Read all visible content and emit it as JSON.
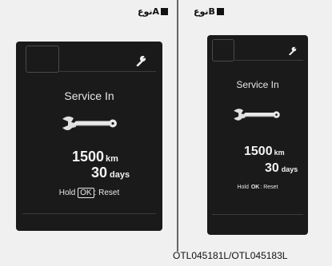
{
  "panels": [
    {
      "type_label": "نوعA",
      "display": {
        "title": "Service In",
        "distance_value": "1500",
        "distance_unit": "km",
        "days_value": "30",
        "days_unit": "days",
        "hold_label": "Hold",
        "ok_label": "OK",
        "reset_label": ": Reset"
      }
    },
    {
      "type_label": "نوعB",
      "display": {
        "title": "Service In",
        "distance_value": "1500",
        "distance_unit": "km",
        "days_value": "30",
        "days_unit": "days",
        "hold_label": "Hold",
        "ok_label": "OK",
        "reset_label": ": Reset"
      }
    }
  ],
  "image_code": "OTL045181L/OTL045183L",
  "icons": [
    "wrench-icon",
    "spanner-icon"
  ],
  "colors": {
    "screen": "#1a1a1a",
    "screen_text": "#e6e6e6",
    "page_background": "#f0f0f0"
  }
}
